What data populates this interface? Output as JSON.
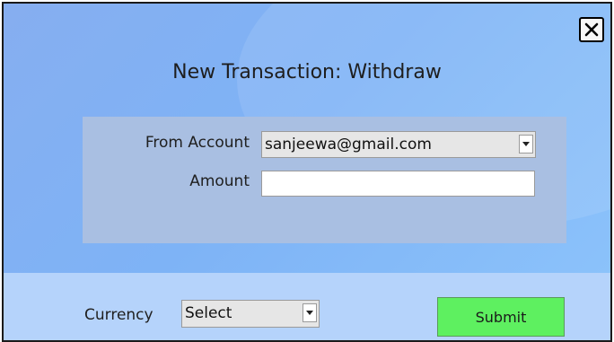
{
  "dialog": {
    "title": "New Transaction: Withdraw"
  },
  "form": {
    "from_account_label": "From Account",
    "from_account_value": "sanjeewa@gmail.com",
    "amount_label": "Amount",
    "amount_value": ""
  },
  "footer": {
    "currency_label": "Currency",
    "currency_value": "Select",
    "submit_label": "Submit"
  },
  "colors": {
    "background": "#7eb3f6",
    "form_panel": "#a9bfe2",
    "footer_band": "#b5d3fb",
    "submit_button": "#5ef060"
  },
  "icons": {
    "close": "close-icon",
    "dropdown": "chevron-down-icon"
  }
}
